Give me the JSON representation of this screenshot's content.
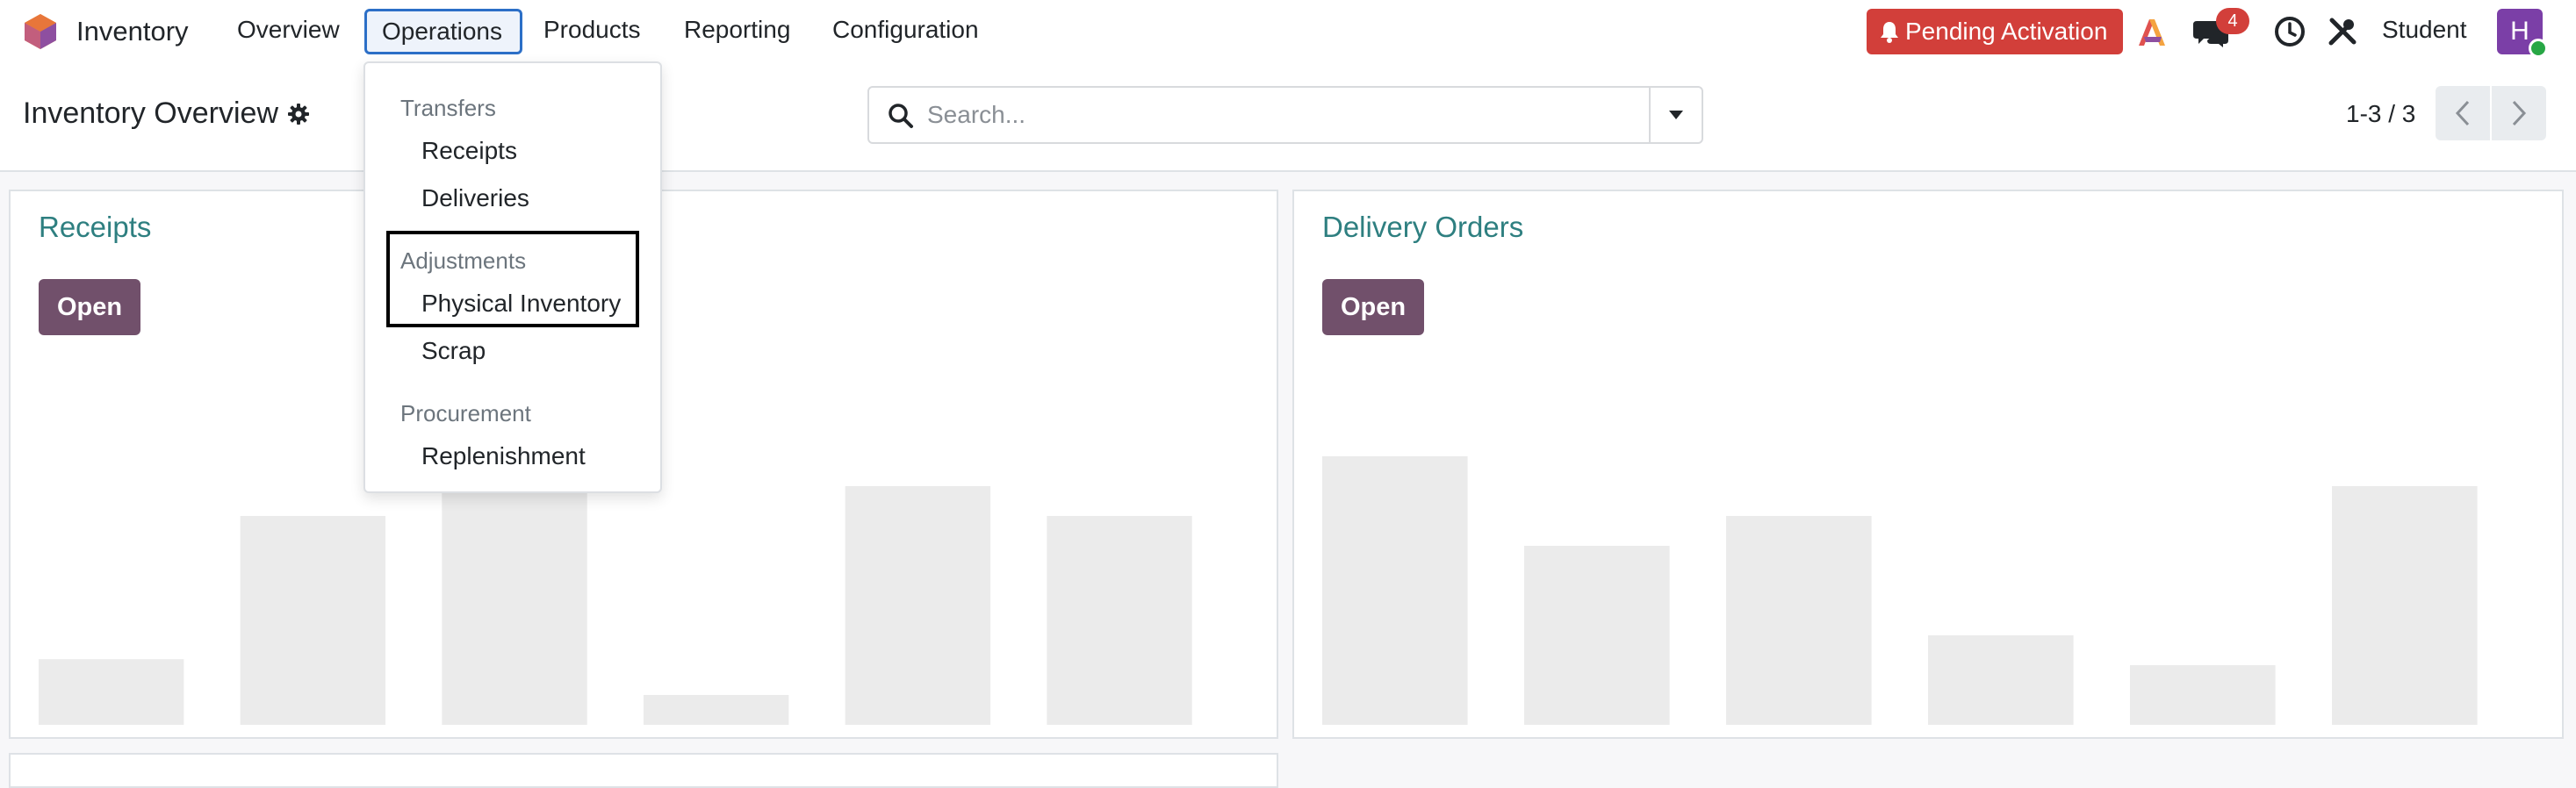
{
  "navbar": {
    "app_name": "Inventory",
    "menu": [
      "Overview",
      "Operations",
      "Products",
      "Reporting",
      "Configuration"
    ],
    "pending_label": "Pending Activation",
    "chat_count": "4",
    "user_name": "Student",
    "avatar_initial": "H",
    "icons": [
      "app-logo-icon",
      "bell-icon",
      "ai-icon",
      "chat-icon",
      "clock-icon",
      "tools-icon"
    ]
  },
  "control_panel": {
    "title": "Inventory Overview",
    "search_placeholder": "Search...",
    "pager": "1-3 / 3"
  },
  "dropdown": {
    "sections": [
      {
        "header": "Transfers",
        "items": [
          "Receipts",
          "Deliveries"
        ]
      },
      {
        "header": "Adjustments",
        "items": [
          "Physical Inventory",
          "Scrap"
        ]
      },
      {
        "header": "Procurement",
        "items": [
          "Replenishment"
        ]
      }
    ],
    "highlighted_item": "Physical Inventory"
  },
  "cards": [
    {
      "title": "Receipts",
      "button": "Open"
    },
    {
      "title": "Delivery Orders",
      "button": "Open"
    }
  ],
  "chart_data": [
    {
      "type": "bar",
      "note": "placeholder sample graph",
      "values": [
        0.22,
        0.7,
        0.8,
        0.1,
        0.8,
        0.7
      ]
    },
    {
      "type": "bar",
      "note": "placeholder sample graph",
      "values": [
        0.9,
        0.6,
        0.7,
        0.3,
        0.2,
        0.8
      ]
    }
  ],
  "colors": {
    "brand": "#71506b",
    "card_title": "#2e7f80",
    "danger": "#d23f3a",
    "placeholder_bar": "#ebebeb"
  }
}
